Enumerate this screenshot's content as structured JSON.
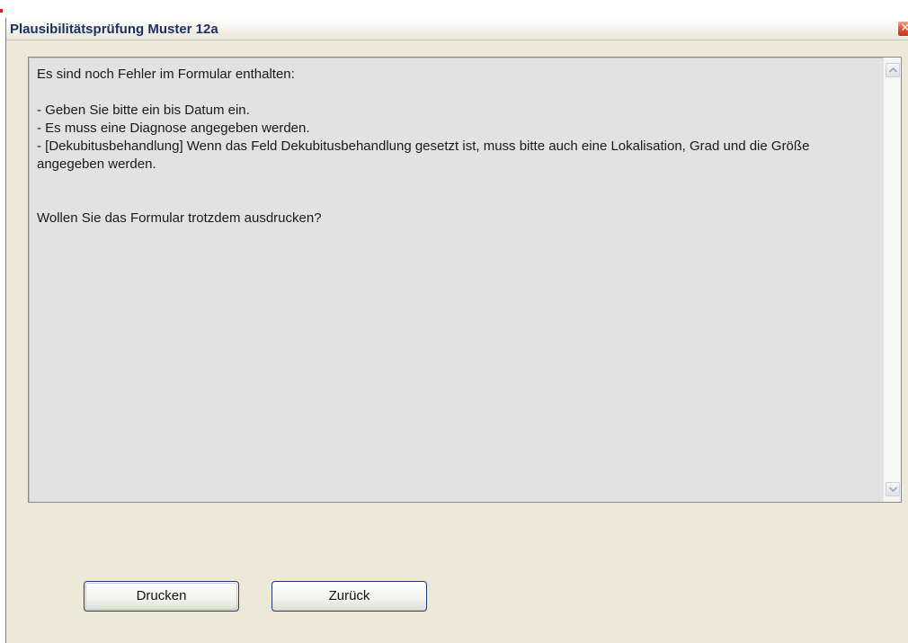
{
  "window": {
    "title": "Plausibilitätsprüfung Muster 12a",
    "close_icon": "close-icon"
  },
  "message": {
    "heading": "Es sind noch Fehler im Formular enthalten:",
    "errors": [
      "- Geben Sie bitte ein bis Datum ein.",
      "- Es muss eine Diagnose angegeben werden.",
      "- [Dekubitusbehandlung] Wenn das Feld Dekubitusbehandlung gesetzt ist, muss bitte auch eine Lokalisation, Grad und die Größe angegeben werden."
    ],
    "question": "Wollen Sie das Formular trotzdem ausdrucken?"
  },
  "buttons": {
    "print_label": "Drucken",
    "back_label": "Zurück"
  },
  "colors": {
    "dialog_bg": "#ece9d8",
    "title_text": "#1c2f66",
    "close_button": "#e0532f",
    "message_bg": "#e2e2e2"
  }
}
